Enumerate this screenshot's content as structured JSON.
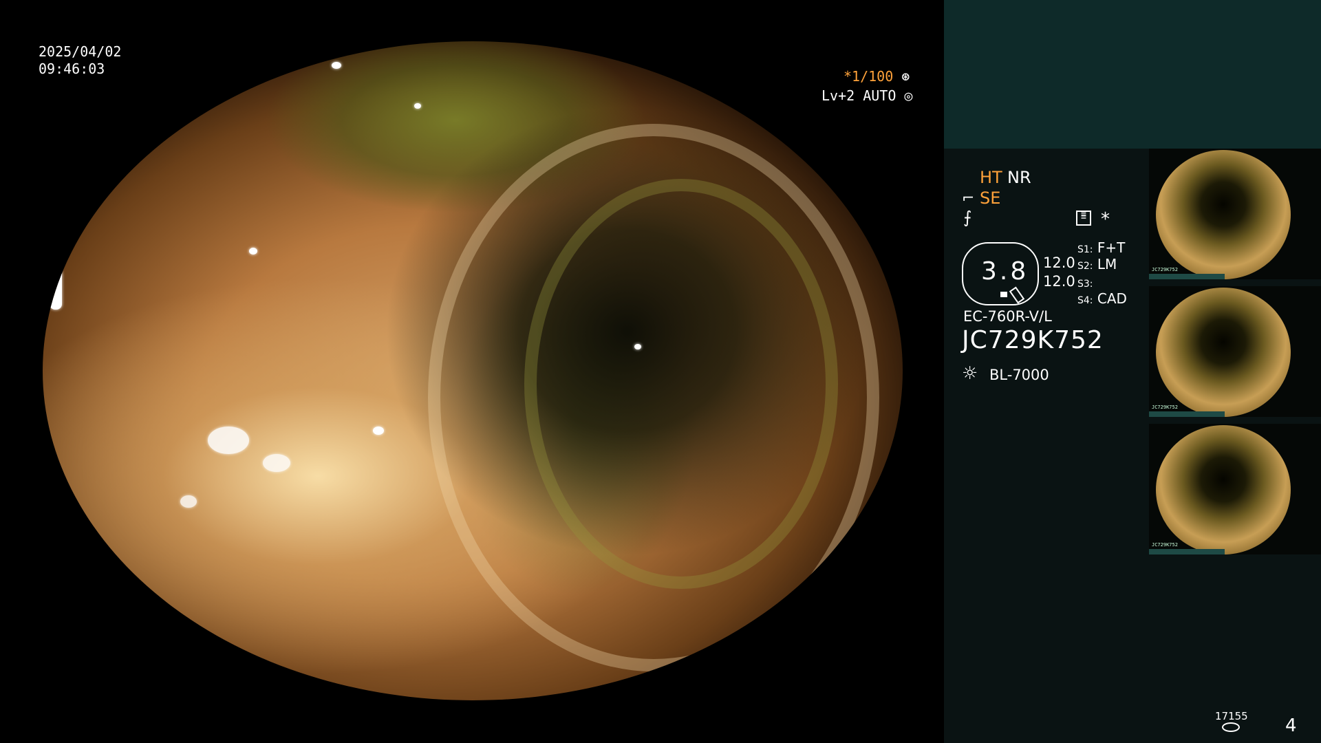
{
  "overlay": {
    "date": "2025/04/02",
    "time": "09:46:03",
    "shutter": "*1/100",
    "level": "Lv+2 AUTO"
  },
  "status": {
    "ht": "HT",
    "nr": "NR",
    "se": "SE",
    "star": "*",
    "gauge_value": "3.8",
    "gauge_r1": "12.0",
    "gauge_r2": "12.0",
    "s1_label": "S1:",
    "s1_value": "F+T",
    "s2_label": "S2:",
    "s2_value": "LM",
    "s3_label": "S3:",
    "s3_value": "",
    "s4_label": "S4:",
    "s4_value": "CAD",
    "model": "EC-760R-V/L",
    "serial": "JC729K752",
    "light": "BL-7000",
    "counter": "17155",
    "page": "4"
  },
  "thumbnails": [
    {
      "caption": "JC729K752"
    },
    {
      "caption": "JC729K752"
    },
    {
      "caption": "JC729K752"
    }
  ],
  "colors": {
    "accent": "#ffa23a",
    "panel_top": "#0e2a29",
    "panel": "#0a1313"
  }
}
